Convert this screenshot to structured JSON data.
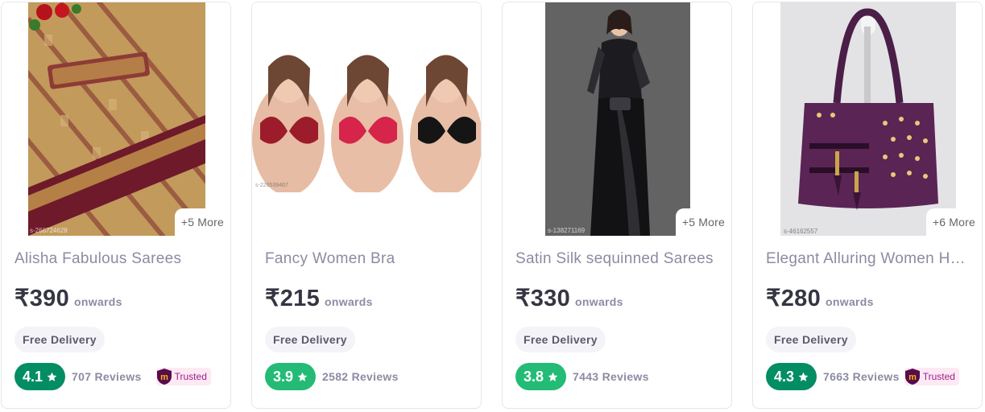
{
  "colors": {
    "rating_dark_green": "#038d63",
    "rating_light_green": "#23bb75",
    "trusted_bg": "#fde9f4",
    "trusted_text": "#9f2089",
    "meesho_brand": "#570d48"
  },
  "products": [
    {
      "title": "Alisha Fabulous Sarees",
      "price": "₹390",
      "price_suffix": "onwards",
      "delivery": "Free Delivery",
      "rating": "4.1",
      "reviews": "707 Reviews",
      "more": "+5 More",
      "trusted": "Trusted",
      "image_code": "s-266724628"
    },
    {
      "title": "Fancy Women Bra",
      "price": "₹215",
      "price_suffix": "onwards",
      "delivery": "Free Delivery",
      "rating": "3.9",
      "reviews": "2582 Reviews",
      "image_code": "s-226539467"
    },
    {
      "title": "Satin Silk sequinned Sarees",
      "price": "₹330",
      "price_suffix": "onwards",
      "delivery": "Free Delivery",
      "rating": "3.8",
      "reviews": "7443 Reviews",
      "more": "+5 More",
      "image_code": "s-138271169"
    },
    {
      "title": "Elegant Alluring Women Handbags",
      "price": "₹280",
      "price_suffix": "onwards",
      "delivery": "Free Delivery",
      "rating": "4.3",
      "reviews": "7663 Reviews",
      "more": "+6 More",
      "trusted": "Trusted",
      "image_code": "s-46162557"
    }
  ]
}
